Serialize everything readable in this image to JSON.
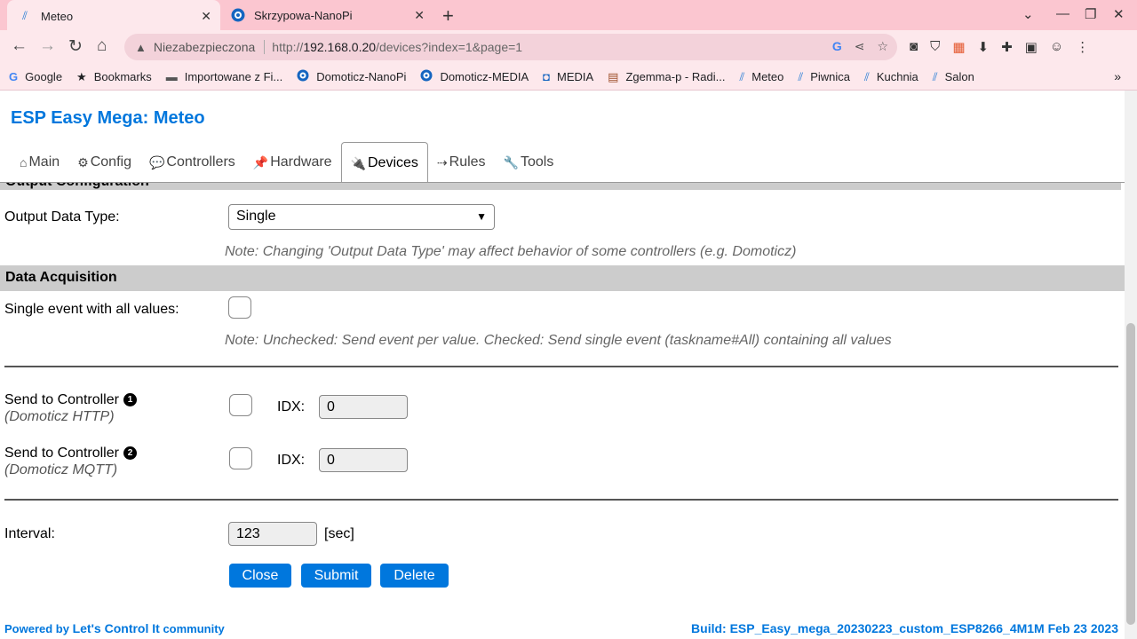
{
  "browser": {
    "tabs": [
      {
        "title": "Meteo",
        "icon": "esp-easy-icon"
      },
      {
        "title": "Skrzypowa-NanoPi",
        "icon": "domoticz-icon"
      }
    ],
    "address": {
      "security_label": "Niezabezpieczona",
      "url_prefix": "http://",
      "url_host": "192.168.0.20",
      "url_path": "/devices?index=1&page=1"
    },
    "bookmarks": [
      {
        "label": "Google",
        "icon": "google-icon"
      },
      {
        "label": "Bookmarks",
        "icon": "star-icon"
      },
      {
        "label": "Importowane z Fi...",
        "icon": "folder-icon"
      },
      {
        "label": "Domoticz-NanoPi",
        "icon": "domoticz-icon"
      },
      {
        "label": "Domoticz-MEDIA",
        "icon": "domoticz-icon"
      },
      {
        "label": "MEDIA",
        "icon": "media-icon"
      },
      {
        "label": "Zgemma-p - Radi...",
        "icon": "radio-icon"
      },
      {
        "label": "Meteo",
        "icon": "esp-easy-icon"
      },
      {
        "label": "Piwnica",
        "icon": "esp-easy-icon"
      },
      {
        "label": "Kuchnia",
        "icon": "esp-easy-icon"
      },
      {
        "label": "Salon",
        "icon": "esp-easy-icon"
      }
    ]
  },
  "app": {
    "title": "ESP Easy Mega: Meteo",
    "menu": [
      {
        "icon": "⌂",
        "label": "Main"
      },
      {
        "icon": "⚙",
        "label": "Config"
      },
      {
        "icon": "💬",
        "label": "Controllers"
      },
      {
        "icon": "📌",
        "label": "Hardware"
      },
      {
        "icon": "🔌",
        "label": "Devices"
      },
      {
        "icon": "⇢",
        "label": "Rules"
      },
      {
        "icon": "🔧",
        "label": "Tools"
      }
    ],
    "active_menu": "Devices"
  },
  "form": {
    "output_config": {
      "section_title": "Output Configuration",
      "label": "Output Data Type:",
      "value": "Single",
      "note": "Note: Changing 'Output Data Type' may affect behavior of some controllers (e.g. Domoticz)"
    },
    "data_acquisition": {
      "section_title": "Data Acquisition",
      "single_event_label": "Single event with all values:",
      "single_event_checked": false,
      "note": "Note: Unchecked: Send event per value. Checked: Send single event (taskname#All) containing all values"
    },
    "controllers": [
      {
        "label": "Send to Controller",
        "badge": "1",
        "sub": "(Domoticz HTTP)",
        "checked": false,
        "idx_label": "IDX:",
        "idx_value": "0"
      },
      {
        "label": "Send to Controller",
        "badge": "2",
        "sub": "(Domoticz MQTT)",
        "checked": false,
        "idx_label": "IDX:",
        "idx_value": "0"
      }
    ],
    "interval": {
      "label": "Interval:",
      "value": "123",
      "unit": "[sec]"
    },
    "buttons": {
      "close": "Close",
      "submit": "Submit",
      "delete": "Delete"
    }
  },
  "footer": {
    "powered_by": "Powered by",
    "community": "Let's Control It",
    "community_suffix": "community",
    "build": "Build: ESP_Easy_mega_20230223_custom_ESP8266_4M1M Feb 23 2023"
  },
  "colors": {
    "accent": "#0077dd",
    "section_bg": "#cccccc",
    "chrome_tabbar": "#fbc6d0",
    "chrome_toolbar": "#fde8ec"
  }
}
